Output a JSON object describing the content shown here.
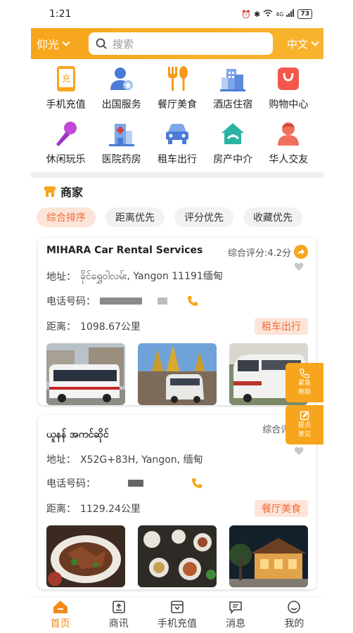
{
  "status": {
    "time": "1:21",
    "battery": "73",
    "network": "4G"
  },
  "header": {
    "city": "仰光",
    "search_placeholder": "搜索",
    "language": "中文"
  },
  "categories": [
    {
      "label": "手机充值",
      "icon": "phone-recharge-icon",
      "icon_text": "充"
    },
    {
      "label": "出国服务",
      "icon": "travel-service-icon"
    },
    {
      "label": "餐厅美食",
      "icon": "restaurant-icon"
    },
    {
      "label": "酒店住宿",
      "icon": "hotel-icon"
    },
    {
      "label": "购物中心",
      "icon": "shopping-bag-icon"
    },
    {
      "label": "休闲玩乐",
      "icon": "microphone-icon"
    },
    {
      "label": "医院药房",
      "icon": "hospital-icon"
    },
    {
      "label": "租车出行",
      "icon": "car-icon"
    },
    {
      "label": "房产中介",
      "icon": "house-icon"
    },
    {
      "label": "华人交友",
      "icon": "person-icon"
    }
  ],
  "merchants": {
    "title": "商家",
    "sort_options": [
      "综合排序",
      "距离优先",
      "评分优先",
      "收藏优先"
    ],
    "active_sort": "综合排序",
    "items": [
      {
        "name": "MIHARA Car Rental Services",
        "rating": "综合评分:4.2分",
        "address_label": "地址：",
        "address": "ခိုင်ရွှေဝါလမ်း, Yangon 11191缅甸",
        "phone_label": "电话号码：",
        "distance_label": "距离：",
        "distance": "1098.67公里",
        "tag": "租车出行"
      },
      {
        "name": "ယူနန် အကင်ဆိုင်",
        "rating": "综合评分:3",
        "address_label": "地址：",
        "address": "X52G+83H, Yangon, 缅甸",
        "phone_label": "电话号码：",
        "distance_label": "距离：",
        "distance": "1129.24公里",
        "tag": "餐厅美食"
      }
    ]
  },
  "floating": {
    "emergency": [
      "紧急",
      "救助"
    ],
    "feedback": [
      "提点",
      "意见"
    ]
  },
  "bottom_nav": [
    {
      "label": "首页",
      "icon": "home-icon",
      "active": true
    },
    {
      "label": "商讯",
      "icon": "news-icon"
    },
    {
      "label": "手机充值",
      "icon": "recharge-icon"
    },
    {
      "label": "消息",
      "icon": "message-icon"
    },
    {
      "label": "我的",
      "icon": "profile-icon"
    }
  ],
  "colors": {
    "accent": "#f7a51c",
    "tag_bg": "#fde4d8",
    "tag_text": "#ef6b3a"
  }
}
